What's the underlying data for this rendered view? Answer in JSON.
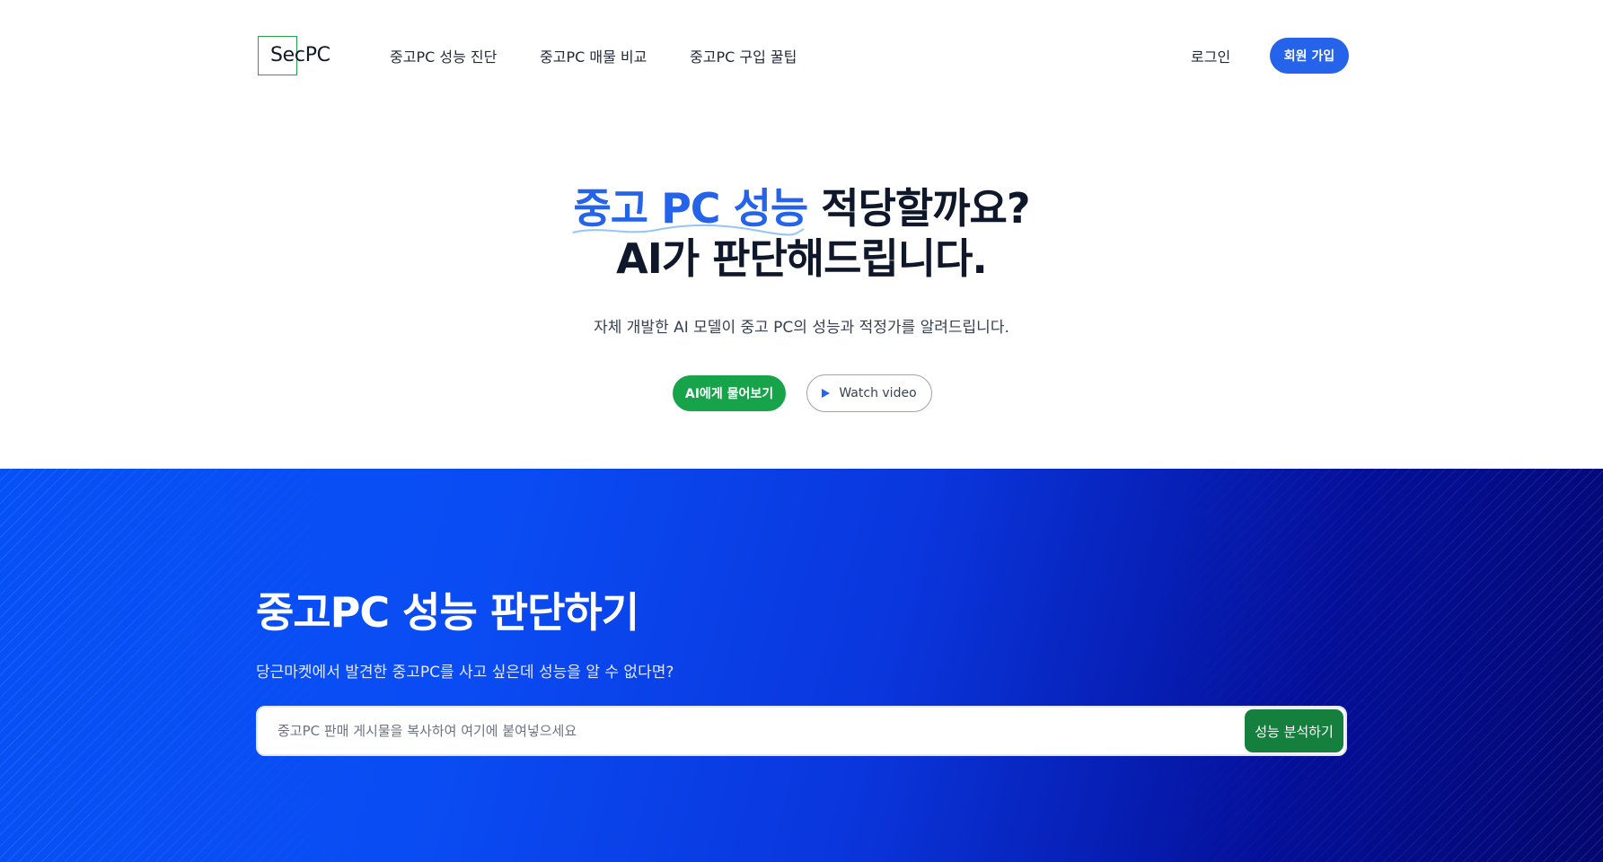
{
  "brand": {
    "logo_text": "SecPC"
  },
  "nav": {
    "items": [
      {
        "label": "중고PC 성능 진단"
      },
      {
        "label": "중고PC 매물 비교"
      },
      {
        "label": "중고PC 구입 꿀팁"
      }
    ],
    "login_label": "로그인",
    "signup_label": "회원 가입"
  },
  "hero": {
    "title_highlight": "중고 PC 성능",
    "title_rest": " 적당할까요?",
    "title_line2": "AI가 판단해드립니다.",
    "subtitle": "자체 개발한 AI 모델이 중고 PC의 성능과 적정가를 알려드립니다.",
    "primary_button": "AI에게 물어보기",
    "secondary_button": "Watch video",
    "secondary_icon": "play-icon"
  },
  "analyze": {
    "title": "중고PC 성능 판단하기",
    "subtitle": "당근마켓에서 발견한 중고PC를 사고 싶은데 성능을 알 수 없다면?",
    "input_placeholder": "중고PC 판매 게시물을 복사하여 여기에 붙여넣으세요",
    "button_label": "성능 분석하기"
  },
  "colors": {
    "accent_blue": "#2563eb",
    "accent_green": "#16a34a",
    "dark_green": "#15803d"
  }
}
